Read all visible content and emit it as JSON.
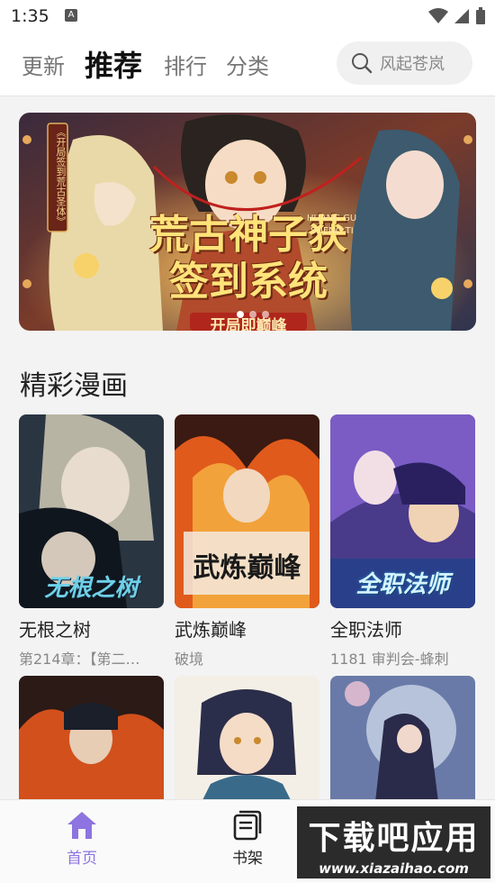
{
  "status_bar": {
    "time": "1:35",
    "notification": "A"
  },
  "header": {
    "tabs": [
      {
        "label": "更新",
        "active": false
      },
      {
        "label": "推荐",
        "active": true
      },
      {
        "label": "排行",
        "active": false
      },
      {
        "label": "分类",
        "active": false
      }
    ],
    "search": {
      "placeholder": "风起苍岚"
    }
  },
  "banner": {
    "title": "荒古神子获签到系统",
    "subtitle": "开局即巅峰",
    "pinyin_line1": "HUANG GU",
    "pinyin_line2": "SHENG TI",
    "side_text": "《开局签到荒古圣体》",
    "dots": 3,
    "active_dot": 0
  },
  "section": {
    "title": "精彩漫画"
  },
  "comics": [
    {
      "title": "无根之树",
      "subtitle": "第214章：【第二…",
      "cover_text": "无根之树"
    },
    {
      "title": "武炼巅峰",
      "subtitle": "破境",
      "cover_text": "武炼巅峰"
    },
    {
      "title": "全职法师",
      "subtitle": "1181 审判会-蜂刺",
      "cover_text": "全职法师"
    }
  ],
  "bottom_nav": {
    "items": [
      {
        "label": "首页",
        "icon": "home-icon",
        "active": true
      },
      {
        "label": "书架",
        "icon": "bookshelf-icon",
        "active": false
      }
    ]
  },
  "watermark": {
    "main": "下载吧应用",
    "url": "www.xiazaihao.com"
  },
  "colors": {
    "accent": "#8d74e0",
    "text": "#222222",
    "muted": "#888888"
  }
}
